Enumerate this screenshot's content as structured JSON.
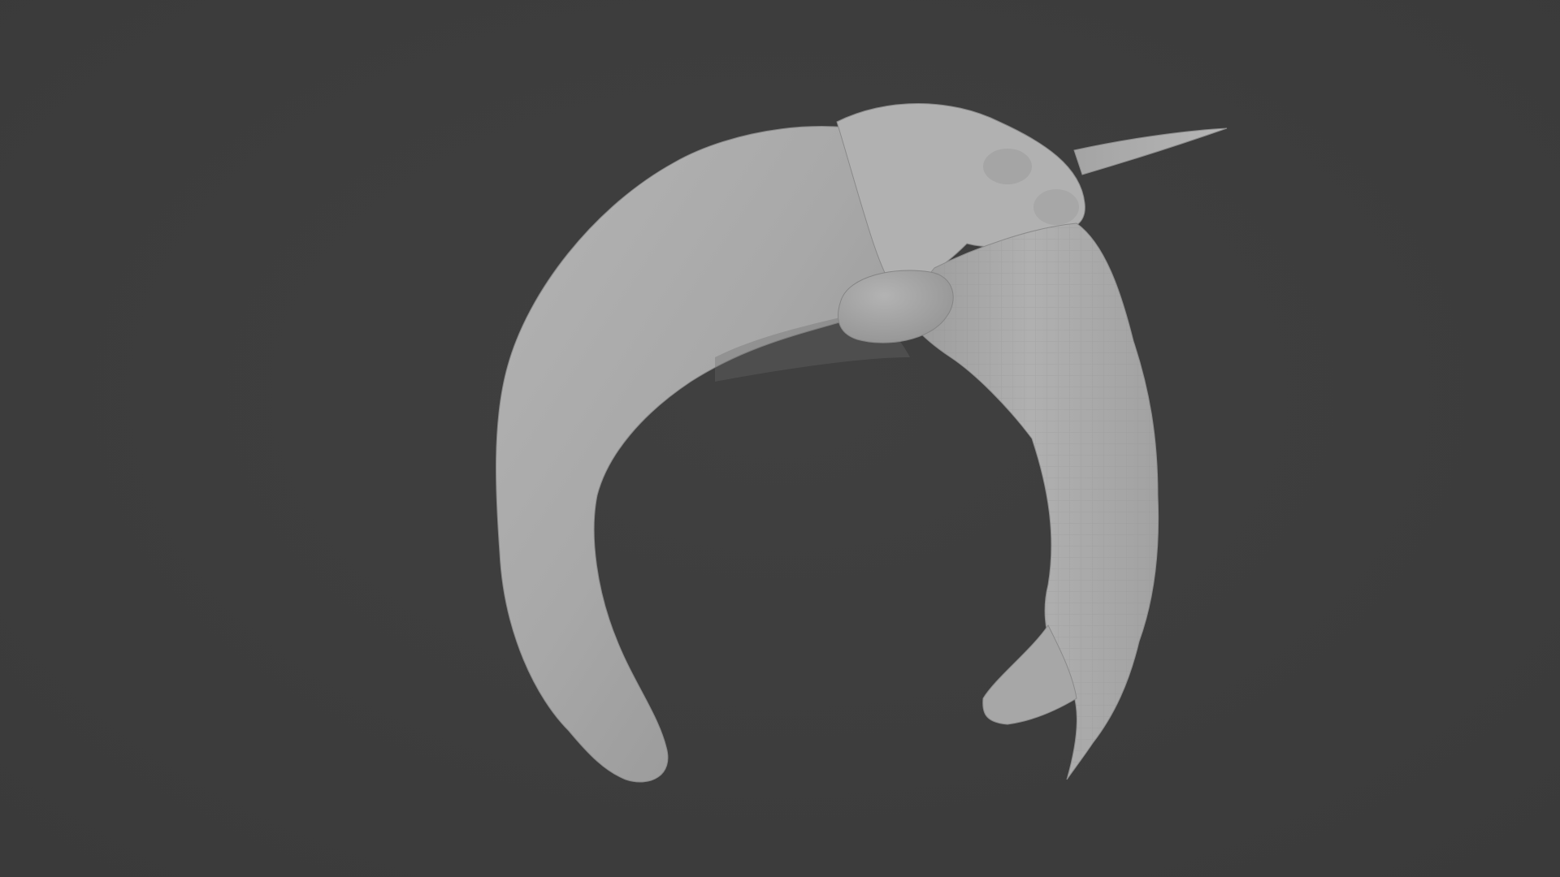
{
  "viewport": {
    "background_color": "#3d3d3d",
    "shading_mode": "solid"
  },
  "model": {
    "type": "sculpt-mesh",
    "subject": "narwhal",
    "material_color": "#a9a9a9",
    "parts": [
      "body",
      "head",
      "tusk",
      "flipper",
      "tail-slab",
      "tail-fluke"
    ]
  }
}
